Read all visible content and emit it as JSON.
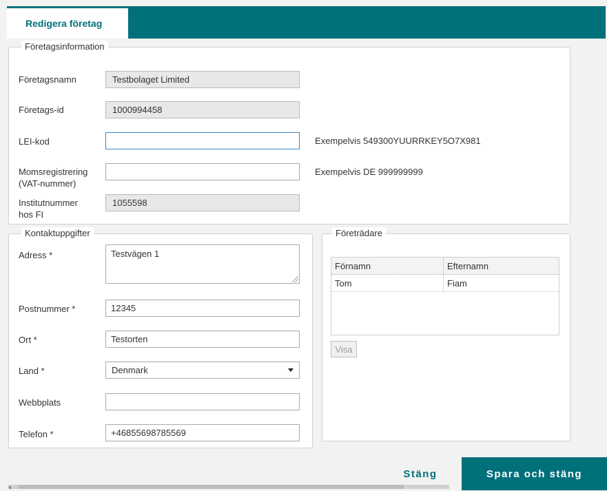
{
  "tabs": {
    "active": "Redigera företag"
  },
  "company": {
    "legend": "Företagsinformation",
    "name": {
      "label": "Företagsnamn",
      "value": "Testbolaget Limited"
    },
    "id": {
      "label": "Företags-id",
      "value": "1000994458"
    },
    "lei": {
      "label": "LEI-kod",
      "value": "",
      "hint": "Exempelvis 549300YUURRKEY5O7X981"
    },
    "vat": {
      "label_line1": "Momsregistrering",
      "label_line2": "(VAT-nummer)",
      "value": "",
      "hint": "Exempelvis DE 999999999"
    },
    "fi": {
      "label_line1": "Institutnummer",
      "label_line2": "hos FI",
      "value": "1055598"
    }
  },
  "contact": {
    "legend": "Kontaktuppgifter",
    "address": {
      "label": "Adress *",
      "value": "Testvägen 1"
    },
    "postal": {
      "label": "Postnummer *",
      "value": "12345"
    },
    "city": {
      "label": "Ort *",
      "value": "Testorten"
    },
    "country": {
      "label": "Land *",
      "value": "Denmark"
    },
    "website": {
      "label": "Webbplats",
      "value": ""
    },
    "phone": {
      "label": "Telefon *",
      "value": "+46855698785569"
    }
  },
  "representatives": {
    "legend": "Företrädare",
    "columns": [
      "Förnamn",
      "Efternamn"
    ],
    "rows": [
      {
        "first": "Tom",
        "last": "Fiam"
      }
    ],
    "view_button": "Visa"
  },
  "footer": {
    "close_label": "Stäng",
    "save_label": "Spara och stäng"
  },
  "colors": {
    "accent": "#00707a",
    "focus": "#3b86c8"
  }
}
